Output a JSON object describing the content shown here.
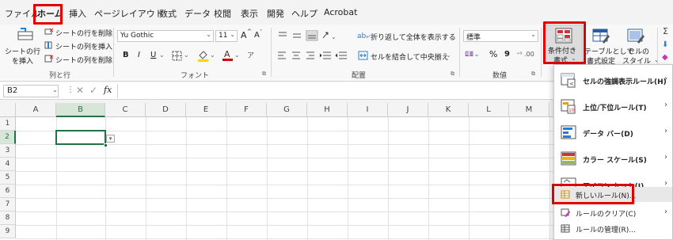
{
  "tabs": [
    "ファイル",
    "ホーム",
    "挿入",
    "ページレイアウト",
    "数式",
    "データ",
    "校閲",
    "表示",
    "開発",
    "ヘルプ",
    "Acrobat"
  ],
  "cells_group": {
    "insert_sheet_row": "シートの行",
    "insert_sheet_row2": "を挿入",
    "delete_rows": "シートの行を削除",
    "insert_cols": "シートの列を挿入",
    "delete_cols": "シートの列を削除",
    "label": "列と行"
  },
  "font_group": {
    "font_name": "Yu Gothic",
    "font_size": "11",
    "grow": "A",
    "shrink": "A",
    "bold": "B",
    "italic": "I",
    "underline": "U",
    "label": "フォント"
  },
  "align_group": {
    "wrap": "折り返して全体を表示する",
    "merge": "セルを結合して中央揃え",
    "label": "配置"
  },
  "number_group": {
    "format": "標準",
    "percent": "%",
    "comma": "9",
    "label": "数値"
  },
  "styles_group": {
    "cond_format_1": "条件付き",
    "cond_format_2": "書式",
    "table_1": "テーブルとして",
    "table_2": "書式設定",
    "cell_style_1": "セルの",
    "cell_style_2": "スタイル"
  },
  "formula_bar": {
    "name_box": "B2",
    "fx": "fx"
  },
  "grid": {
    "columns": [
      "A",
      "B",
      "C",
      "D",
      "E",
      "F",
      "G",
      "H",
      "I",
      "J",
      "K",
      "L",
      "M"
    ],
    "rows": [
      "1",
      "2",
      "3",
      "4",
      "5",
      "6",
      "7",
      "8",
      "9"
    ],
    "selected_cell": "B2"
  },
  "menu": {
    "items": [
      {
        "label": "セルの強調表示ルール(H)",
        "arrow": "›"
      },
      {
        "label": "上位/下位ルール(T)",
        "arrow": "›"
      },
      {
        "label": "データ バー(D)",
        "arrow": "›"
      },
      {
        "label": "カラー スケール(S)",
        "arrow": "›"
      },
      {
        "label": "アイコン セット(I)",
        "arrow": "›"
      },
      {
        "label": "新しいルール(N)...",
        "arrow": ""
      },
      {
        "label": "ルールのクリア(C)",
        "arrow": "›"
      },
      {
        "label": "ルールの管理(R)...",
        "arrow": ""
      }
    ]
  },
  "colors": {
    "highlight": "#e00000",
    "accent_green": "#107c41",
    "selection": "#217346"
  }
}
